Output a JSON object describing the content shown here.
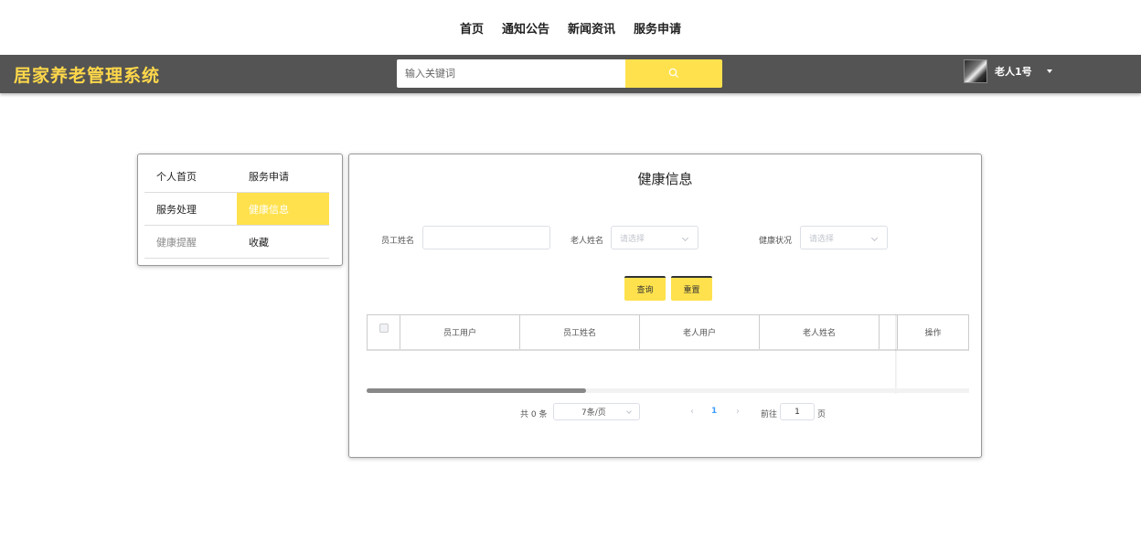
{
  "topnav": {
    "items": [
      "首页",
      "通知公告",
      "新闻资讯",
      "服务申请"
    ]
  },
  "header": {
    "logo": "居家养老管理系统",
    "search_placeholder": "输入关键词",
    "search_icon": "search-icon",
    "user_name": "老人1号",
    "accent_color": "#ffe14d"
  },
  "sidebar": {
    "items": [
      {
        "label": "个人首页",
        "active": false
      },
      {
        "label": "服务申请",
        "active": false
      },
      {
        "label": "服务处理",
        "active": false
      },
      {
        "label": "健康信息",
        "active": true
      },
      {
        "label": "健康提醒",
        "active": false
      },
      {
        "label": "收藏",
        "active": false
      }
    ]
  },
  "main": {
    "title": "健康信息",
    "filters": {
      "staff_name_label": "员工姓名",
      "elder_name_label": "老人姓名",
      "elder_name_placeholder": "请选择",
      "health_status_label": "健康状况",
      "health_status_placeholder": "请选择"
    },
    "buttons": {
      "query": "查询",
      "reset": "重置"
    },
    "table": {
      "columns": [
        "员工用户",
        "员工姓名",
        "老人用户",
        "老人姓名",
        "操作"
      ],
      "rows": []
    },
    "pagination": {
      "total": "共 0 条",
      "page_size": "7条/页",
      "current_page": "1",
      "goto_label": "前往",
      "goto_value": "1",
      "page_suffix": "页"
    }
  }
}
